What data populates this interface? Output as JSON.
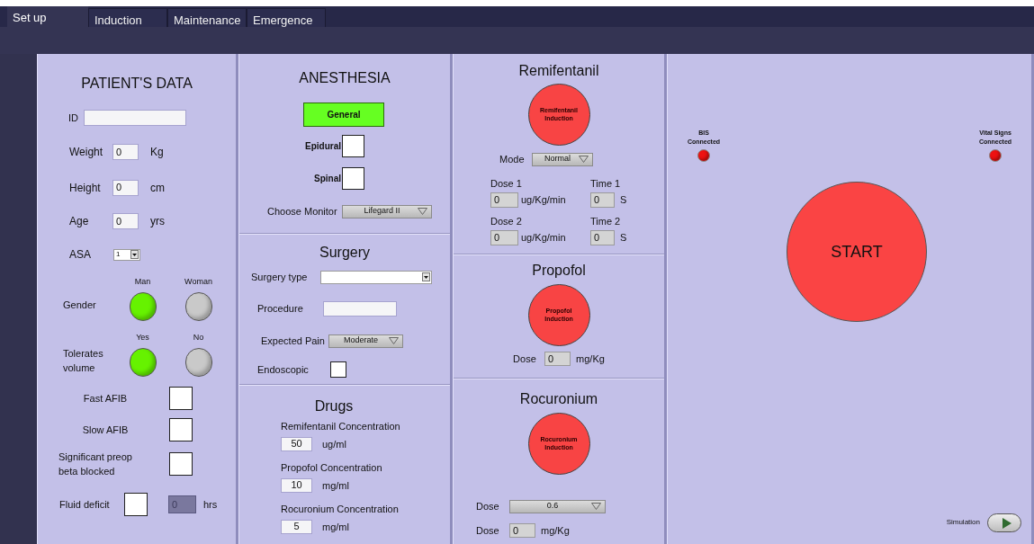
{
  "tabs": [
    {
      "label": "Set up",
      "selected": true
    },
    {
      "label": "Induction",
      "selected": false
    },
    {
      "label": "Maintenance",
      "selected": false
    },
    {
      "label": "Emergence",
      "selected": false
    }
  ],
  "patient": {
    "title": "PATIENT'S DATA",
    "id": {
      "label": "ID"
    },
    "measures": [
      {
        "label": "Weight",
        "value": "0",
        "unit": "Kg"
      },
      {
        "label": "Height",
        "value": "0",
        "unit": "cm"
      },
      {
        "label": "Age",
        "value": "0",
        "unit": "yrs"
      }
    ],
    "asa": {
      "label": "ASA",
      "value": "1"
    },
    "choices": [
      {
        "label": "Gender",
        "options": [
          {
            "label": "Man",
            "on": true
          },
          {
            "label": "Woman",
            "on": false
          }
        ]
      },
      {
        "label": "Tolerates volume",
        "options": [
          {
            "label": "Yes",
            "on": true
          },
          {
            "label": "No",
            "on": false
          }
        ]
      }
    ],
    "conditions": [
      {
        "label": "Fast AFIB",
        "checked": false
      },
      {
        "label": "Slow AFIB",
        "checked": false
      },
      {
        "label": "Significant preop beta blocked",
        "checked": false
      }
    ],
    "fluid_deficit": {
      "label": "Fluid deficit",
      "checked": false,
      "value": "0",
      "unit": "hrs",
      "disabled": true
    }
  },
  "anesthesia": {
    "title": "ANESTHESIA",
    "general": {
      "label": "General",
      "on": true
    },
    "types": [
      {
        "label": "Epidural",
        "checked": false
      },
      {
        "label": "Spinal",
        "checked": false
      }
    ],
    "monitor": {
      "label": "Choose Monitor",
      "value": "Lifegard II"
    }
  },
  "surgery": {
    "title": "Surgery",
    "surgery_type": {
      "label": "Surgery type"
    },
    "procedure": {
      "label": "Procedure"
    },
    "expected_pain": {
      "label": "Expected Pain",
      "value": "Moderate"
    },
    "endoscopic": {
      "label": "Endoscopic",
      "checked": false
    }
  },
  "drugs": {
    "title": "Drugs",
    "items": [
      {
        "label": "Remifentanil Concentration",
        "value": "50",
        "unit": "ug/ml"
      },
      {
        "label": "Propofol Concentration",
        "value": "10",
        "unit": "mg/ml"
      },
      {
        "label": "Rocuronium Concentration",
        "value": "5",
        "unit": "mg/ml"
      }
    ]
  },
  "remifentanil": {
    "title": "Remifentanil",
    "button": {
      "label": "Remifentanil Induction",
      "on": false
    },
    "mode": {
      "label": "Mode",
      "value": "Normal"
    },
    "doses": [
      {
        "label": "Dose 1",
        "value": "0",
        "unit": "ug/Kg/min",
        "time_label": "Time 1",
        "time_value": "0",
        "time_unit": "S"
      },
      {
        "label": "Dose 2",
        "value": "0",
        "unit": "ug/Kg/min",
        "time_label": "Time 2",
        "time_value": "0",
        "time_unit": "S"
      }
    ]
  },
  "propofol": {
    "title": "Propofol",
    "button": {
      "label": "Propofol Induction",
      "on": false
    },
    "dose": {
      "label": "Dose",
      "value": "0",
      "unit": "mg/Kg"
    }
  },
  "rocuronium": {
    "title": "Rocuronium",
    "button": {
      "label": "Rocuronium Induction",
      "on": false
    },
    "dose_select": {
      "label": "Dose",
      "value": "0.6"
    },
    "dose": {
      "label": "Dose",
      "value": "0",
      "unit": "mg/Kg"
    }
  },
  "status": {
    "indicators": [
      {
        "label": "BIS Connected",
        "on": false
      },
      {
        "label": "Vital Signs Connected",
        "on": false
      }
    ],
    "start": {
      "label": "START",
      "on": false
    },
    "simulation": {
      "label": "Simulation",
      "on": false
    }
  }
}
